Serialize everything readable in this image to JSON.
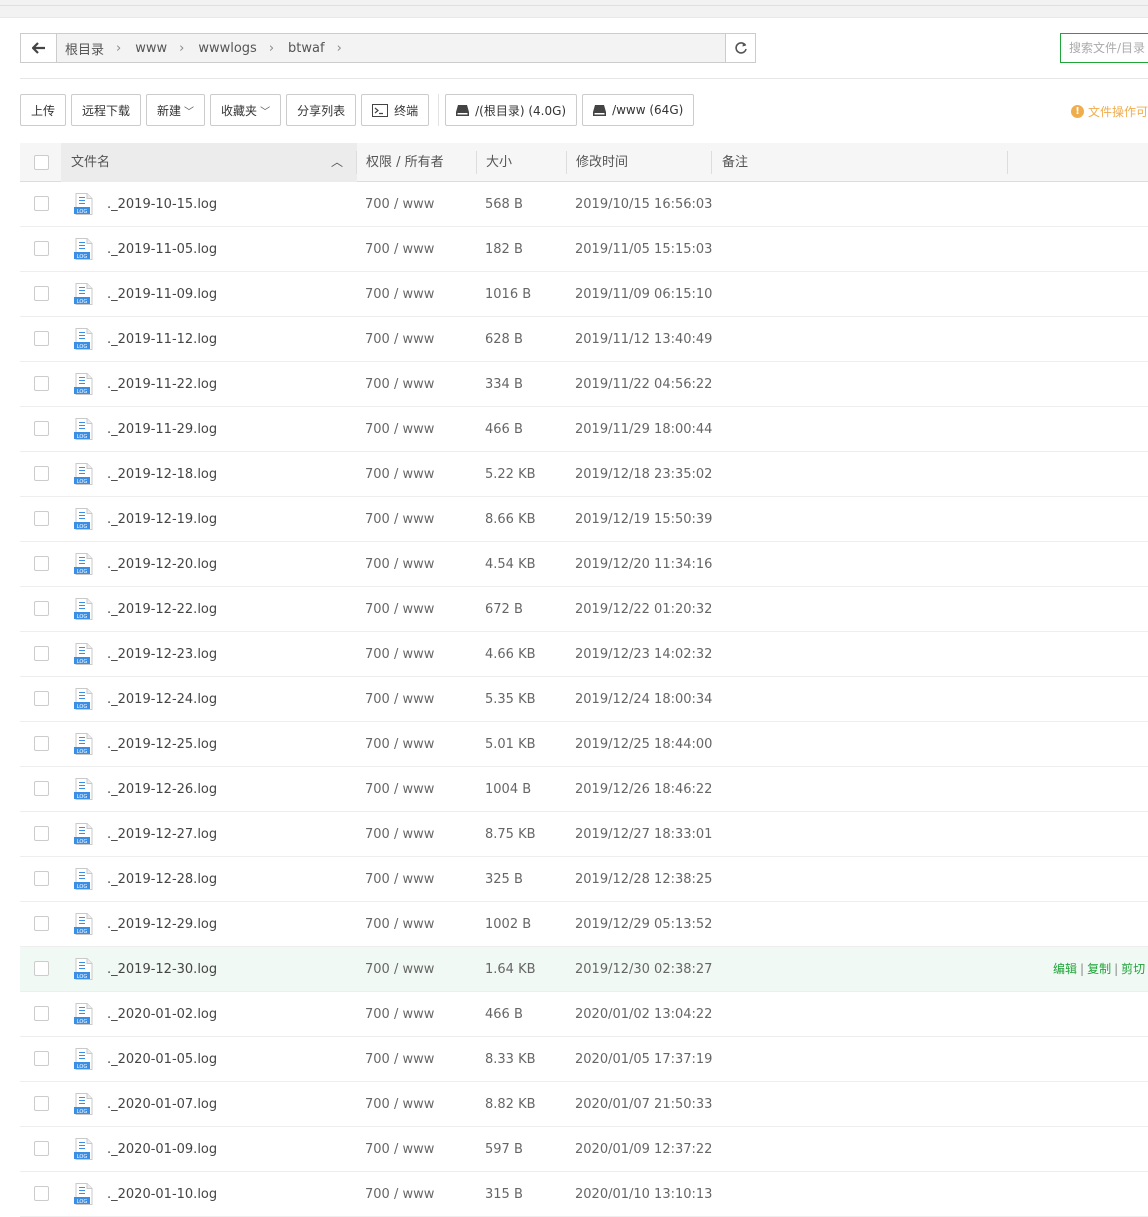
{
  "breadcrumb": {
    "items": [
      "根目录",
      "www",
      "wwwlogs",
      "btwaf"
    ]
  },
  "search": {
    "placeholder": "搜索文件/目录"
  },
  "toolbar": {
    "upload": "上传",
    "remote_download": "远程下载",
    "new": "新建",
    "favorites": "收藏夹",
    "share_list": "分享列表",
    "terminal": "终端",
    "disk_root": "/(根目录) (4.0G)",
    "disk_www": "/www (64G)"
  },
  "notice": "文件操作可",
  "table": {
    "headers": {
      "name": "文件名",
      "perm": "权限 / 所有者",
      "size": "大小",
      "mtime": "修改时间",
      "note": "备注"
    },
    "row_actions": {
      "edit": "编辑",
      "copy": "复制",
      "cut": "剪切"
    },
    "highlighted_row": 17,
    "rows": [
      {
        "name": "._2019-10-15.log",
        "perm": "700 / www",
        "size": "568 B",
        "mtime": "2019/10/15 16:56:03"
      },
      {
        "name": "._2019-11-05.log",
        "perm": "700 / www",
        "size": "182 B",
        "mtime": "2019/11/05 15:15:03"
      },
      {
        "name": "._2019-11-09.log",
        "perm": "700 / www",
        "size": "1016 B",
        "mtime": "2019/11/09 06:15:10"
      },
      {
        "name": "._2019-11-12.log",
        "perm": "700 / www",
        "size": "628 B",
        "mtime": "2019/11/12 13:40:49"
      },
      {
        "name": "._2019-11-22.log",
        "perm": "700 / www",
        "size": "334 B",
        "mtime": "2019/11/22 04:56:22"
      },
      {
        "name": "._2019-11-29.log",
        "perm": "700 / www",
        "size": "466 B",
        "mtime": "2019/11/29 18:00:44"
      },
      {
        "name": "._2019-12-18.log",
        "perm": "700 / www",
        "size": "5.22 KB",
        "mtime": "2019/12/18 23:35:02"
      },
      {
        "name": "._2019-12-19.log",
        "perm": "700 / www",
        "size": "8.66 KB",
        "mtime": "2019/12/19 15:50:39"
      },
      {
        "name": "._2019-12-20.log",
        "perm": "700 / www",
        "size": "4.54 KB",
        "mtime": "2019/12/20 11:34:16"
      },
      {
        "name": "._2019-12-22.log",
        "perm": "700 / www",
        "size": "672 B",
        "mtime": "2019/12/22 01:20:32"
      },
      {
        "name": "._2019-12-23.log",
        "perm": "700 / www",
        "size": "4.66 KB",
        "mtime": "2019/12/23 14:02:32"
      },
      {
        "name": "._2019-12-24.log",
        "perm": "700 / www",
        "size": "5.35 KB",
        "mtime": "2019/12/24 18:00:34"
      },
      {
        "name": "._2019-12-25.log",
        "perm": "700 / www",
        "size": "5.01 KB",
        "mtime": "2019/12/25 18:44:00"
      },
      {
        "name": "._2019-12-26.log",
        "perm": "700 / www",
        "size": "1004 B",
        "mtime": "2019/12/26 18:46:22"
      },
      {
        "name": "._2019-12-27.log",
        "perm": "700 / www",
        "size": "8.75 KB",
        "mtime": "2019/12/27 18:33:01"
      },
      {
        "name": "._2019-12-28.log",
        "perm": "700 / www",
        "size": "325 B",
        "mtime": "2019/12/28 12:38:25"
      },
      {
        "name": "._2019-12-29.log",
        "perm": "700 / www",
        "size": "1002 B",
        "mtime": "2019/12/29 05:13:52"
      },
      {
        "name": "._2019-12-30.log",
        "perm": "700 / www",
        "size": "1.64 KB",
        "mtime": "2019/12/30 02:38:27"
      },
      {
        "name": "._2020-01-02.log",
        "perm": "700 / www",
        "size": "466 B",
        "mtime": "2020/01/02 13:04:22"
      },
      {
        "name": "._2020-01-05.log",
        "perm": "700 / www",
        "size": "8.33 KB",
        "mtime": "2020/01/05 17:37:19"
      },
      {
        "name": "._2020-01-07.log",
        "perm": "700 / www",
        "size": "8.82 KB",
        "mtime": "2020/01/07 21:50:33"
      },
      {
        "name": "._2020-01-09.log",
        "perm": "700 / www",
        "size": "597 B",
        "mtime": "2020/01/09 12:37:22"
      },
      {
        "name": "._2020-01-10.log",
        "perm": "700 / www",
        "size": "315 B",
        "mtime": "2020/01/10 13:10:13"
      }
    ]
  },
  "icons": {
    "back": "arrow-left-icon",
    "refresh": "refresh-icon",
    "terminal": "terminal-icon",
    "disk": "disk-icon",
    "sort": "sort-up-icon",
    "file": "log-file-icon",
    "info": "info-icon"
  },
  "colors": {
    "accent": "#20a53a",
    "warning": "#f0ad4e",
    "file_icon": "#3a8ee6",
    "highlight_row": "#f1f9f4"
  }
}
